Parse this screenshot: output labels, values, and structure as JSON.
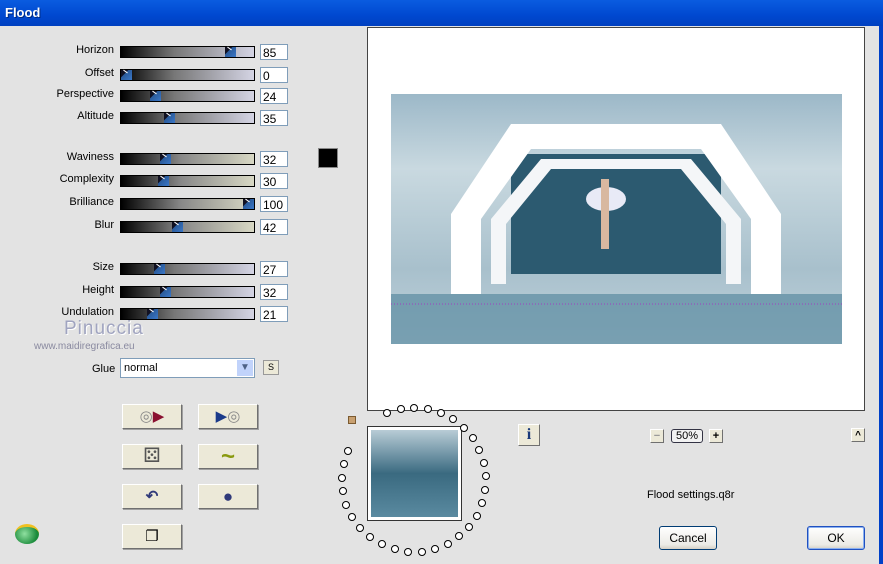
{
  "window": {
    "title": "Flood"
  },
  "sliders": [
    {
      "label": "Horizon",
      "value": "85",
      "pct": 85,
      "group": "a",
      "row": 0
    },
    {
      "label": "Offset",
      "value": "0",
      "pct": 0,
      "group": "a",
      "row": 1
    },
    {
      "label": "Perspective",
      "value": "24",
      "pct": 24,
      "group": "a",
      "row": 2
    },
    {
      "label": "Altitude",
      "value": "35",
      "pct": 35,
      "group": "a",
      "row": 3
    },
    {
      "label": "Waviness",
      "value": "32",
      "pct": 32,
      "group": "b",
      "row": 4
    },
    {
      "label": "Complexity",
      "value": "30",
      "pct": 30,
      "group": "b",
      "row": 5
    },
    {
      "label": "Brilliance",
      "value": "100",
      "pct": 100,
      "group": "b",
      "row": 6
    },
    {
      "label": "Blur",
      "value": "42",
      "pct": 42,
      "group": "b",
      "row": 7
    },
    {
      "label": "Size",
      "value": "27",
      "pct": 27,
      "group": "a",
      "row": 8
    },
    {
      "label": "Height",
      "value": "32",
      "pct": 32,
      "group": "a",
      "row": 9
    },
    {
      "label": "Undulation",
      "value": "21",
      "pct": 21,
      "group": "a",
      "row": 10
    }
  ],
  "color_swatch": "#000000",
  "watermark": {
    "name": "Pinuccia",
    "url": "www.maidiregrafica.eu"
  },
  "glue": {
    "label": "Glue",
    "value": "normal",
    "s_button": "S"
  },
  "zoom": {
    "value": "50%",
    "minus": "−",
    "plus": "+"
  },
  "collapse": "^",
  "info": "i",
  "settings_file": "Flood settings.q8r",
  "buttons": {
    "cancel": "Cancel",
    "ok": "OK"
  }
}
